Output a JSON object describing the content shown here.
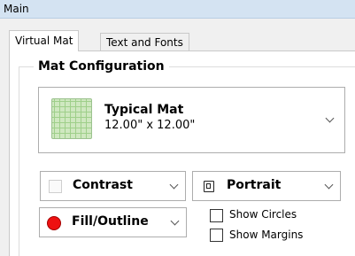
{
  "panel_title": "Main",
  "tabs": [
    {
      "label": "Virtual Mat",
      "active": true
    },
    {
      "label": "Text and Fonts",
      "active": false
    }
  ],
  "group": {
    "title": "Mat Configuration"
  },
  "mat": {
    "name": "Typical Mat",
    "size": "12.00\" x 12.00\"",
    "icon": "grid-mat-icon"
  },
  "contrast": {
    "label": "Contrast",
    "icon": "white-square-icon"
  },
  "orientation": {
    "label": "Portrait",
    "icon": "portrait-icon"
  },
  "fill": {
    "label": "Fill/Outline",
    "icon": "red-dot-icon",
    "color": "#ee1111"
  },
  "checkboxes": [
    {
      "label": "Show Circles",
      "checked": false
    },
    {
      "label": "Show Margins",
      "checked": false
    }
  ]
}
